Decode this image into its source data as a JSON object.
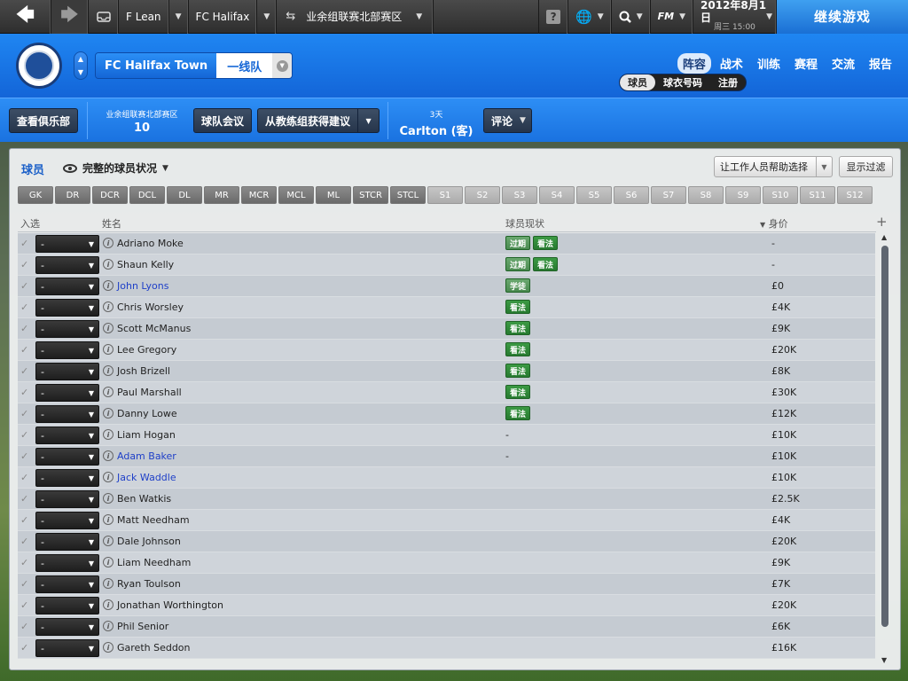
{
  "topbar": {
    "back_icon": "back-arrow-icon",
    "forward_icon": "forward-arrow-icon",
    "manager": "F Lean",
    "club": "FC Halifax",
    "competition": "业余组联赛北部赛区",
    "date": "2012年8月1日",
    "day_time": "周三 15:00",
    "continue_label": "继续游戏",
    "logo_text": "FM"
  },
  "header": {
    "club_name": "FC Halifax Town",
    "squad": "一线队",
    "tabs": [
      "阵容",
      "战术",
      "训练",
      "赛程",
      "交流",
      "报告"
    ],
    "sub_tabs": [
      "球员",
      "球衣号码",
      "注册"
    ]
  },
  "actions": {
    "view_club": "查看俱乐部",
    "league_name": "业余组联赛北部赛区",
    "league_position": "10",
    "team_meeting": "球队会议",
    "coach_advice": "从教练组获得建议",
    "next_match_days": "3天",
    "next_match_opponent": "Carlton (客)",
    "comment": "评论"
  },
  "panel": {
    "title": "球员",
    "view": "完整的球员状况",
    "staff_help": "让工作人员帮助选择",
    "show_filter": "显示过滤",
    "positions_dark": [
      "GK",
      "DR",
      "DCR",
      "DCL",
      "DL",
      "MR",
      "MCR",
      "MCL",
      "ML",
      "STCR",
      "STCL"
    ],
    "positions_light": [
      "S1",
      "S2",
      "S3",
      "S4",
      "S5",
      "S6",
      "S7",
      "S8",
      "S9",
      "S10",
      "S11",
      "S12"
    ],
    "columns": {
      "select": "入选",
      "name": "姓名",
      "status": "球员现状",
      "value": "身价"
    }
  },
  "players": [
    {
      "name": "Adriano Moke",
      "link": false,
      "tags": [
        [
          "过期",
          "pale"
        ],
        [
          "看法",
          ""
        ]
      ],
      "dash": false,
      "value": "-",
      "sel": "-"
    },
    {
      "name": "Shaun Kelly",
      "link": false,
      "tags": [
        [
          "过期",
          "pale"
        ],
        [
          "看法",
          ""
        ]
      ],
      "dash": false,
      "value": "-",
      "sel": "-"
    },
    {
      "name": "John Lyons",
      "link": true,
      "tags": [
        [
          "学徒",
          "pale"
        ]
      ],
      "dash": false,
      "value": "£0",
      "sel": "-"
    },
    {
      "name": "Chris Worsley",
      "link": false,
      "tags": [
        [
          "看法",
          ""
        ]
      ],
      "dash": false,
      "value": "£4K",
      "sel": "-"
    },
    {
      "name": "Scott McManus",
      "link": false,
      "tags": [
        [
          "看法",
          ""
        ]
      ],
      "dash": false,
      "value": "£9K",
      "sel": "-"
    },
    {
      "name": "Lee Gregory",
      "link": false,
      "tags": [
        [
          "看法",
          ""
        ]
      ],
      "dash": false,
      "value": "£20K",
      "sel": "-"
    },
    {
      "name": "Josh Brizell",
      "link": false,
      "tags": [
        [
          "看法",
          ""
        ]
      ],
      "dash": false,
      "value": "£8K",
      "sel": "-"
    },
    {
      "name": "Paul Marshall",
      "link": false,
      "tags": [
        [
          "看法",
          ""
        ]
      ],
      "dash": false,
      "value": "£30K",
      "sel": "-"
    },
    {
      "name": "Danny Lowe",
      "link": false,
      "tags": [
        [
          "看法",
          ""
        ]
      ],
      "dash": false,
      "value": "£12K",
      "sel": "-"
    },
    {
      "name": "Liam Hogan",
      "link": false,
      "tags": [],
      "dash": true,
      "value": "£10K",
      "sel": "-"
    },
    {
      "name": "Adam Baker",
      "link": true,
      "tags": [],
      "dash": true,
      "value": "£10K",
      "sel": "-"
    },
    {
      "name": "Jack Waddle",
      "link": true,
      "tags": [],
      "dash": false,
      "value": "£10K",
      "sel": "-"
    },
    {
      "name": "Ben Watkis",
      "link": false,
      "tags": [],
      "dash": false,
      "value": "£2.5K",
      "sel": "-"
    },
    {
      "name": "Matt Needham",
      "link": false,
      "tags": [],
      "dash": false,
      "value": "£4K",
      "sel": "-"
    },
    {
      "name": "Dale Johnson",
      "link": false,
      "tags": [],
      "dash": false,
      "value": "£20K",
      "sel": "-"
    },
    {
      "name": "Liam Needham",
      "link": false,
      "tags": [],
      "dash": false,
      "value": "£9K",
      "sel": "-"
    },
    {
      "name": "Ryan Toulson",
      "link": false,
      "tags": [],
      "dash": false,
      "value": "£7K",
      "sel": "-"
    },
    {
      "name": "Jonathan Worthington",
      "link": false,
      "tags": [],
      "dash": false,
      "value": "£20K",
      "sel": "-"
    },
    {
      "name": "Phil Senior",
      "link": false,
      "tags": [],
      "dash": false,
      "value": "£6K",
      "sel": "-"
    },
    {
      "name": "Gareth Seddon",
      "link": false,
      "tags": [],
      "dash": false,
      "value": "£16K",
      "sel": "-"
    }
  ]
}
